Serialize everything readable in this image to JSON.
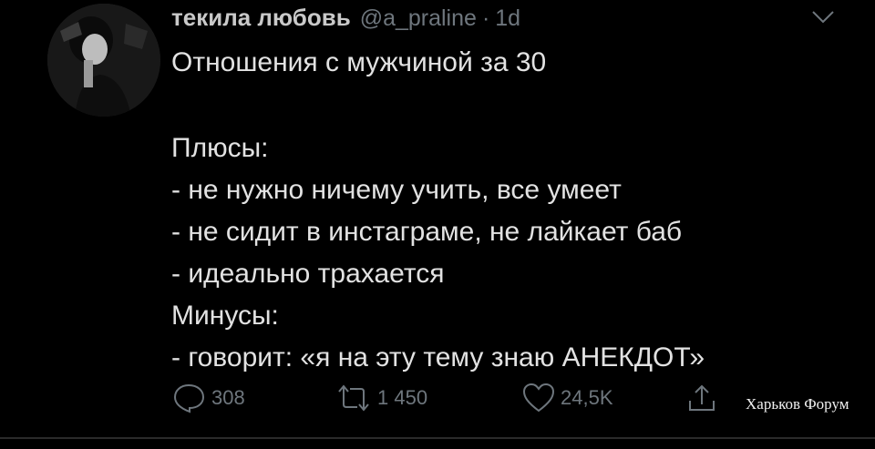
{
  "tweet": {
    "display_name": "текила любовь",
    "handle": "@a_praline",
    "separator": "·",
    "time": "1d",
    "lines": [
      "Отношения с мужчиной за 30",
      "",
      "Плюсы:",
      "- не нужно ничему учить, все умеет",
      "- не сидит в инстаграме, не лайкает баб",
      "- идеально трахается",
      "Минусы:",
      "- говорит: «я на эту тему знаю АНЕКДОТ»"
    ]
  },
  "actions": {
    "reply_count": "308",
    "retweet_count": "1 450",
    "like_count": "24,5K"
  },
  "watermark": "Харьков Форум",
  "icons": {
    "more": "chevron-down-icon",
    "reply": "reply-icon",
    "retweet": "retweet-icon",
    "like": "heart-icon",
    "share": "share-icon"
  },
  "colors": {
    "background": "#000000",
    "text": "#e2e2e2",
    "muted": "#6e767d"
  }
}
